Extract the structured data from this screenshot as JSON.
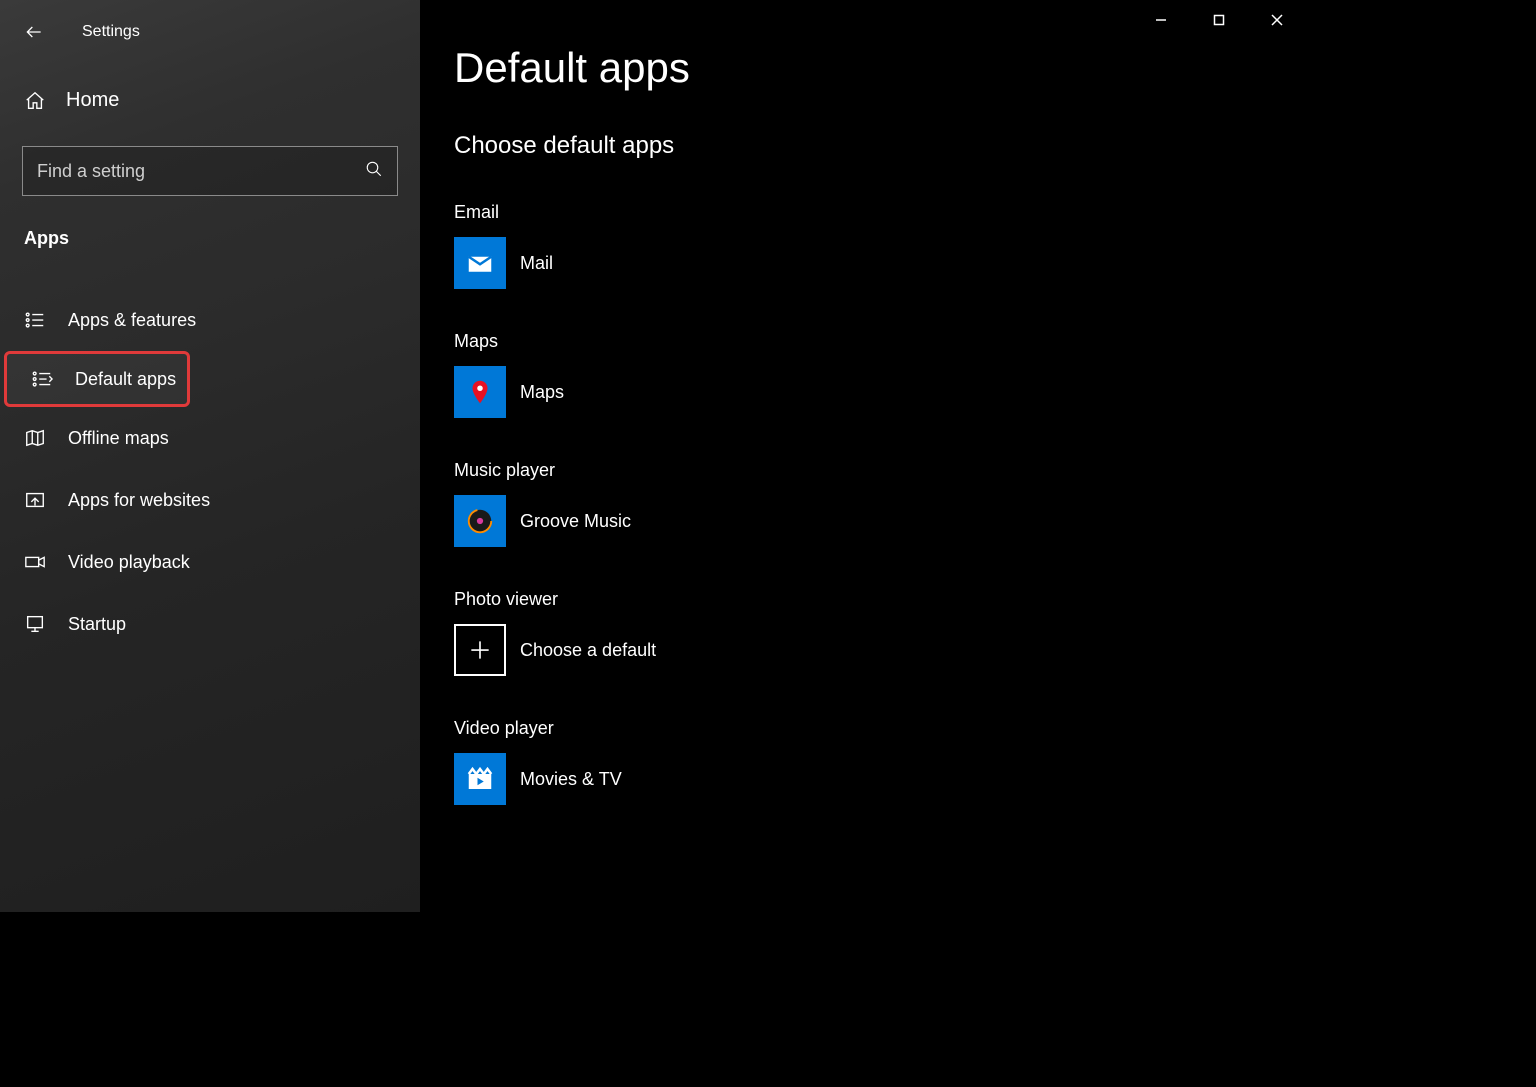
{
  "header": {
    "title": "Settings"
  },
  "sidebar": {
    "home": "Home",
    "search_placeholder": "Find a setting",
    "section": "Apps",
    "items": [
      {
        "label": "Apps & features"
      },
      {
        "label": "Default apps"
      },
      {
        "label": "Offline maps"
      },
      {
        "label": "Apps for websites"
      },
      {
        "label": "Video playback"
      },
      {
        "label": "Startup"
      }
    ]
  },
  "main": {
    "title": "Default apps",
    "section": "Choose default apps",
    "groups": [
      {
        "label": "Email",
        "app": "Mail"
      },
      {
        "label": "Maps",
        "app": "Maps"
      },
      {
        "label": "Music player",
        "app": "Groove Music"
      },
      {
        "label": "Photo viewer",
        "app": "Choose a default"
      },
      {
        "label": "Video player",
        "app": "Movies & TV"
      }
    ]
  }
}
